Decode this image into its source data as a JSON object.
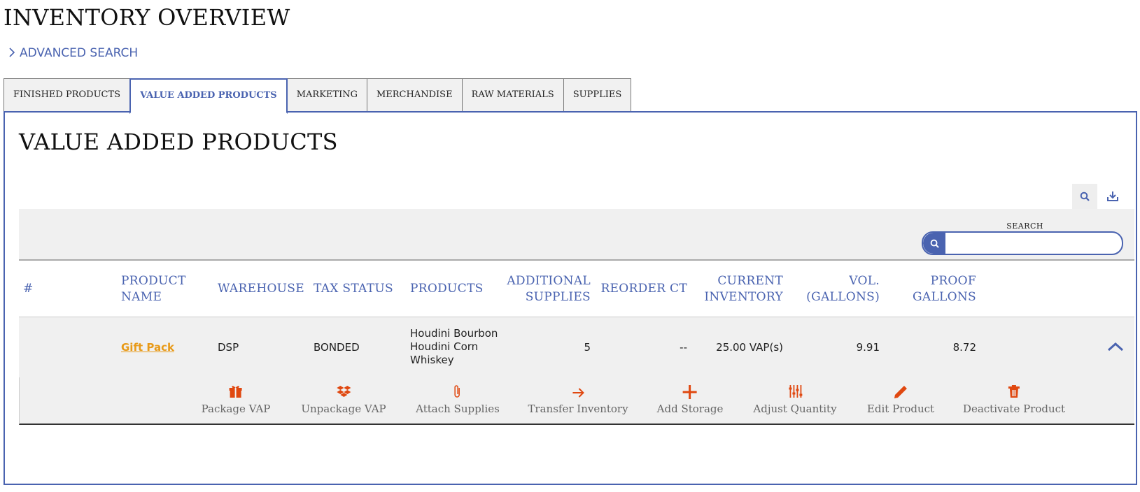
{
  "page": {
    "title": "INVENTORY OVERVIEW",
    "advanced_search": "ADVANCED SEARCH"
  },
  "tabs": [
    {
      "label": "FINISHED PRODUCTS",
      "active": false
    },
    {
      "label": "VALUE ADDED PRODUCTS",
      "active": true
    },
    {
      "label": "MARKETING",
      "active": false
    },
    {
      "label": "MERCHANDISE",
      "active": false
    },
    {
      "label": "RAW MATERIALS",
      "active": false
    },
    {
      "label": "SUPPLIES",
      "active": false
    }
  ],
  "section": {
    "title": "VALUE ADDED PRODUCTS"
  },
  "toolbar": {
    "search_icon": "search-icon",
    "export_icon": "download-icon"
  },
  "search": {
    "label": "SEARCH",
    "value": "",
    "placeholder": ""
  },
  "table": {
    "headers": {
      "num": "#",
      "product_name_1": "PRODUCT",
      "product_name_2": "NAME",
      "warehouse": "WAREHOUSE",
      "tax_status": "TAX STATUS",
      "products": "PRODUCTS",
      "additional_1": "ADDITIONAL",
      "additional_2": "SUPPLIES",
      "reorder": "REORDER CT",
      "current_1": "CURRENT",
      "current_2": "INVENTORY",
      "vol_1": "VOL.",
      "vol_2": "(GALLONS)",
      "proof_1": "PROOF",
      "proof_2": "GALLONS"
    },
    "rows": [
      {
        "product_name": "Gift Pack",
        "warehouse": "DSP",
        "tax_status": "BONDED",
        "products": [
          "Houdini Bourbon",
          "Houdini Corn",
          "Whiskey"
        ],
        "additional_supplies": "5",
        "reorder_ct": "--",
        "current_inventory": "25.00 VAP(s)",
        "vol_gallons": "9.91",
        "proof_gallons": "8.72"
      }
    ]
  },
  "actions": [
    {
      "label": "Package VAP",
      "icon": "gift-icon"
    },
    {
      "label": "Unpackage VAP",
      "icon": "dropbox-icon"
    },
    {
      "label": "Attach Supplies",
      "icon": "paperclip-icon"
    },
    {
      "label": "Transfer Inventory",
      "icon": "arrow-right-icon"
    },
    {
      "label": "Add Storage",
      "icon": "plus-icon"
    },
    {
      "label": "Adjust Quantity",
      "icon": "sliders-icon"
    },
    {
      "label": "Edit Product",
      "icon": "pencil-icon"
    },
    {
      "label": "Deactivate Product",
      "icon": "trash-icon"
    }
  ],
  "colors": {
    "accent": "#4a63b0",
    "link": "#e89a18",
    "action_icon": "#e04810"
  }
}
